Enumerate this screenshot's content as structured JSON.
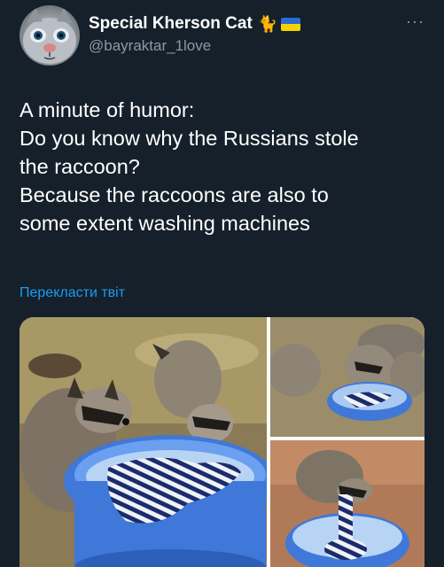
{
  "user": {
    "display_name": "Special Kherson Cat",
    "emoji_cat": "🐈",
    "flag_colors": [
      "#2a6ad3",
      "#f5d300"
    ],
    "handle": "@bayraktar_1love",
    "avatar_icon": "cat-avatar"
  },
  "more_label": "···",
  "tweet": {
    "lines": [
      "A minute of humor:",
      "Do you know why the Russians stole",
      "the raccoon?",
      "Because the raccoons are also to",
      "some extent washing machines"
    ]
  },
  "translate_label": "Перекласти твіт",
  "media": {
    "images": [
      "raccoons-washing-large",
      "raccoons-washing-top-right",
      "raccoon-washing-bottom-right"
    ]
  },
  "colors": {
    "background": "#15202b",
    "secondary_text": "#8b98a5",
    "link": "#1d9bf0"
  }
}
